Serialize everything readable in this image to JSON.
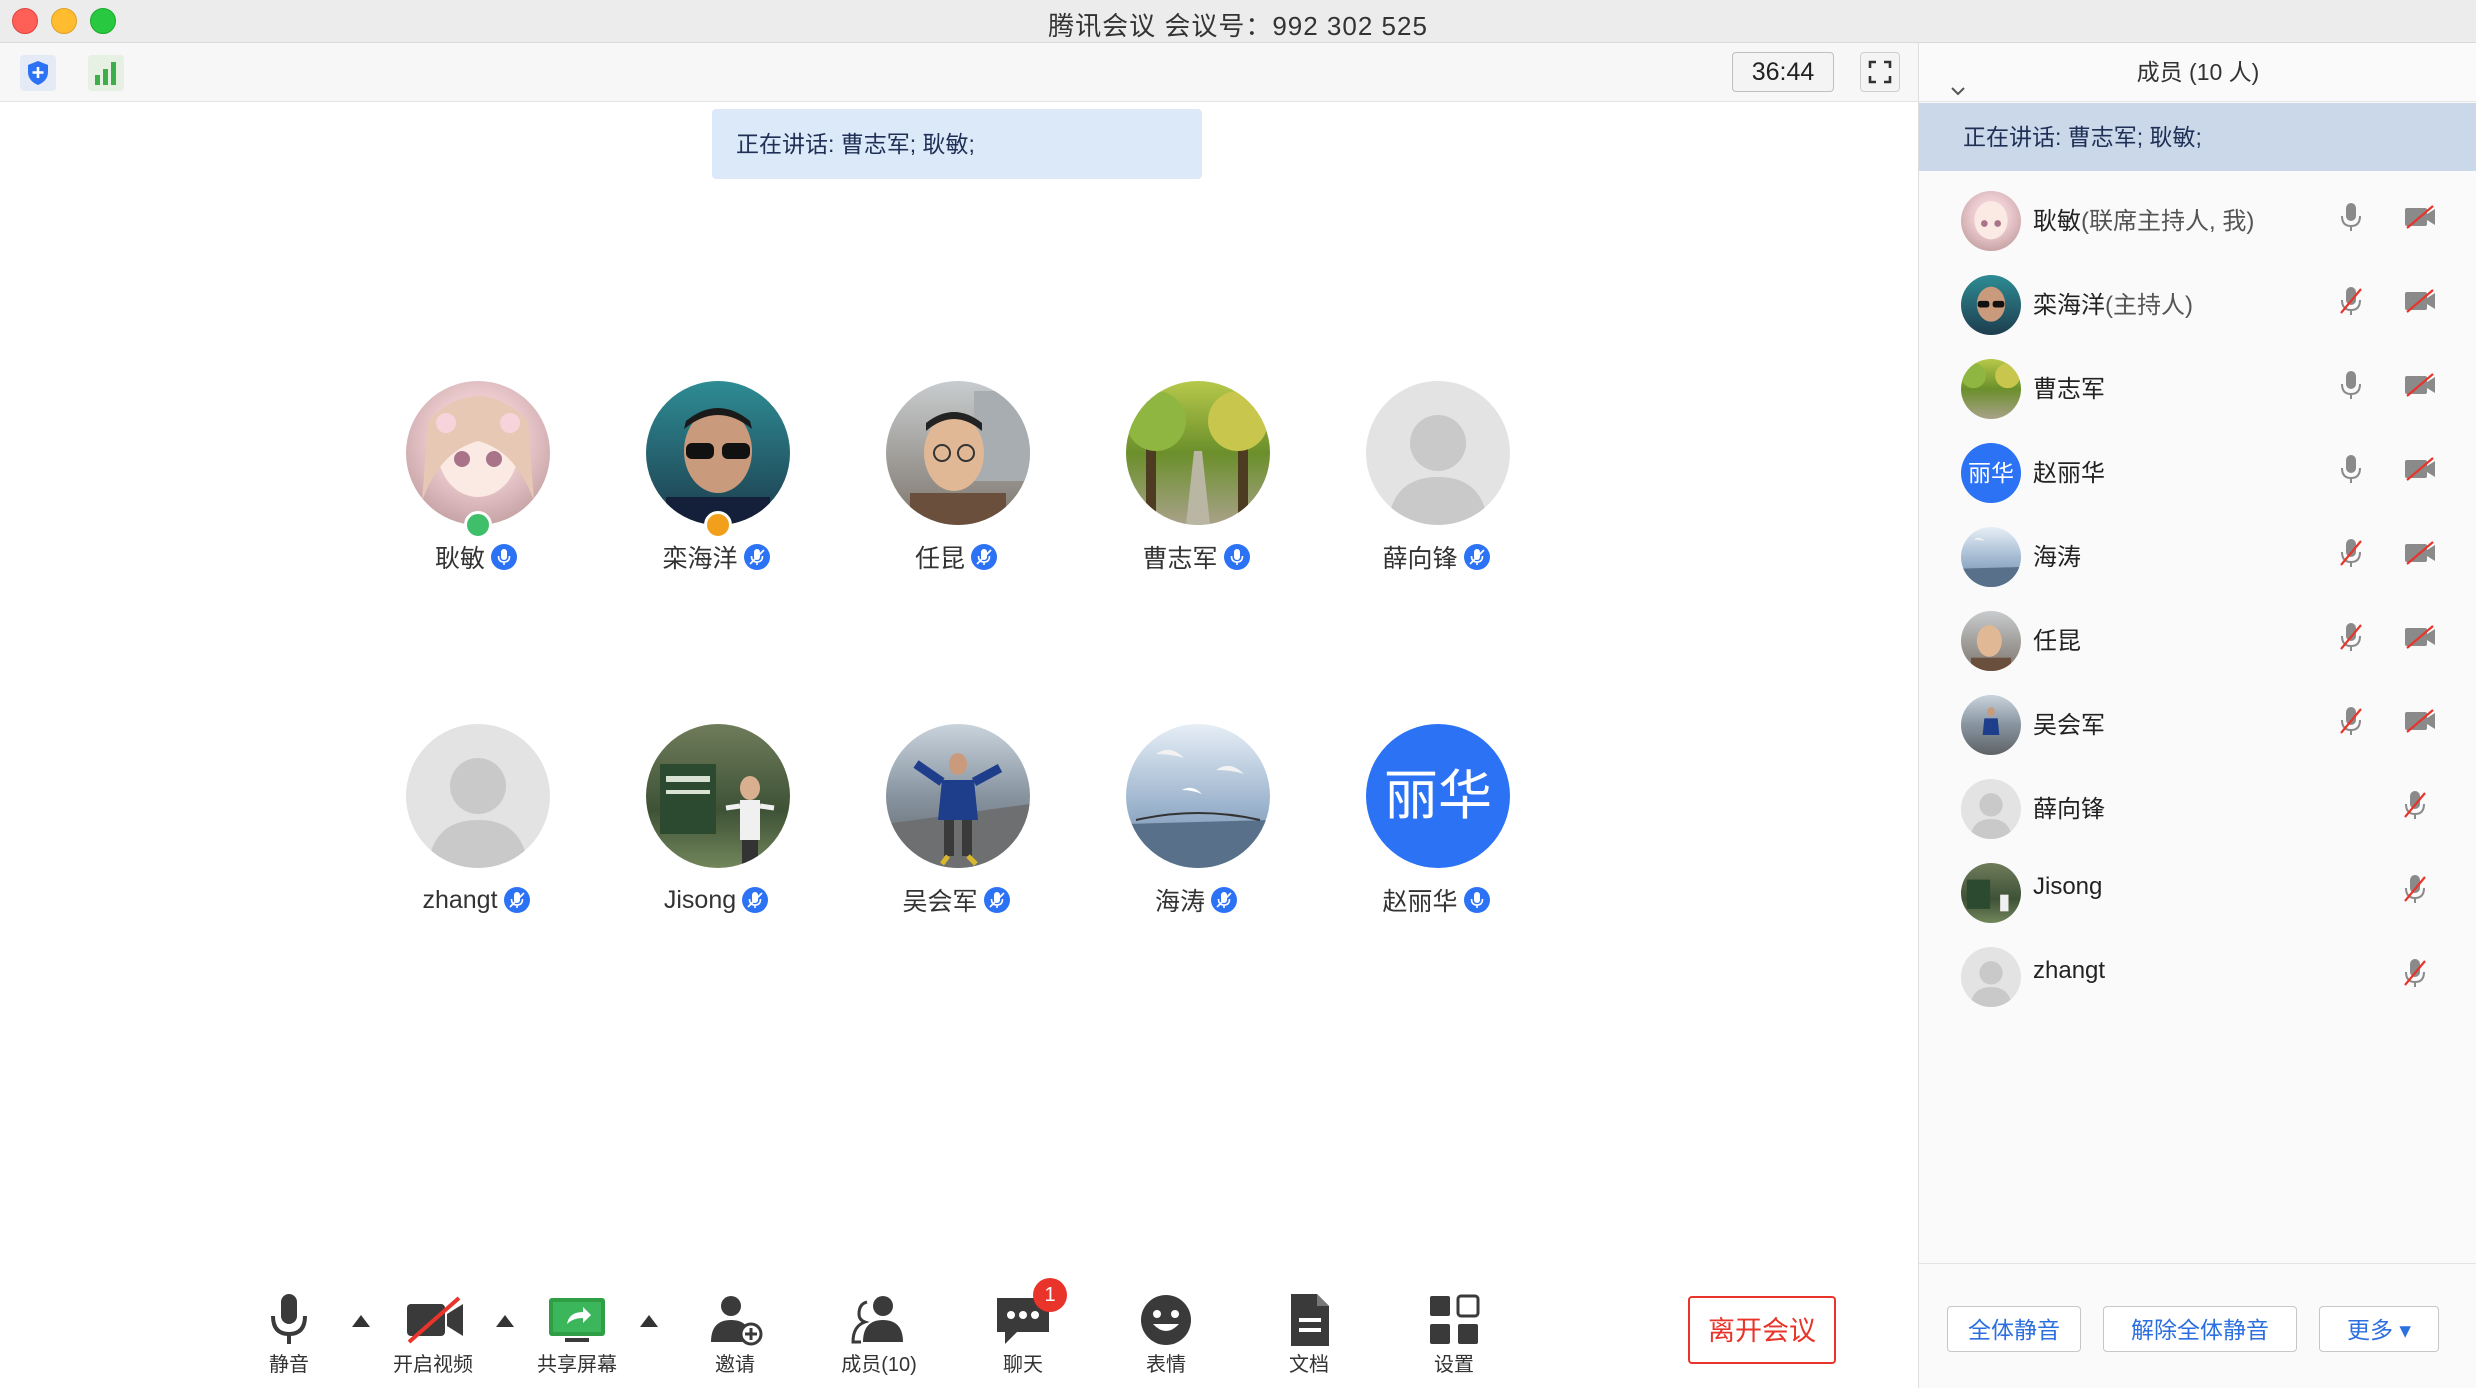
{
  "window": {
    "title": "腾讯会议 会议号：992 302 525"
  },
  "toolbar_top": {
    "timer": "36:44",
    "icons": [
      "shield-icon",
      "signal-strength-icon",
      "fullscreen-icon"
    ]
  },
  "speaking_banner": "正在讲话: 曹志军; 耿敏;",
  "tiles": [
    {
      "name": "耿敏",
      "avatar": "anime-girl",
      "badge": "green-host"
    },
    {
      "name": "栾海洋",
      "avatar": "man-sunglasses",
      "badge": "orange-host"
    },
    {
      "name": "任昆",
      "avatar": "man-glasses"
    },
    {
      "name": "曹志军",
      "avatar": "tree-path"
    },
    {
      "name": "薛向锋",
      "avatar": "default"
    },
    {
      "name": "zhangt",
      "avatar": "default"
    },
    {
      "name": "Jisong",
      "avatar": "man-sign"
    },
    {
      "name": "吴会军",
      "avatar": "man-bridge"
    },
    {
      "name": "海涛",
      "avatar": "seagulls"
    },
    {
      "name": "赵丽华",
      "avatar": "text",
      "avatar_text": "丽华"
    }
  ],
  "bottom_bar": {
    "mute": "静音",
    "video": "开启视频",
    "share": "共享屏幕",
    "invite": "邀请",
    "members": "成员(10)",
    "chat": "聊天",
    "chat_badge": "1",
    "emoji": "表情",
    "docs": "文档",
    "settings": "设置",
    "leave": "离开会议"
  },
  "panel": {
    "header": "成员 (10 人)",
    "speaking": "正在讲话: 曹志军; 耿敏;",
    "members": [
      {
        "name": "耿敏",
        "role": "(联席主持人, 我)",
        "avatar": "anime-girl",
        "mic": "on",
        "cam": "off"
      },
      {
        "name": "栾海洋",
        "role": "(主持人)",
        "avatar": "man-sunglasses",
        "mic": "muted",
        "cam": "off"
      },
      {
        "name": "曹志军",
        "role": "",
        "avatar": "tree-path",
        "mic": "on",
        "cam": "off"
      },
      {
        "name": "赵丽华",
        "role": "",
        "avatar": "text",
        "avatar_text": "丽华",
        "mic": "on",
        "cam": "off"
      },
      {
        "name": "海涛",
        "role": "",
        "avatar": "seagulls",
        "mic": "muted",
        "cam": "off"
      },
      {
        "name": "任昆",
        "role": "",
        "avatar": "man-glasses",
        "mic": "muted",
        "cam": "off"
      },
      {
        "name": "吴会军",
        "role": "",
        "avatar": "man-bridge",
        "mic": "muted",
        "cam": "off"
      },
      {
        "name": "薛向锋",
        "role": "",
        "avatar": "default",
        "mic": "muted-only"
      },
      {
        "name": "Jisong",
        "role": "",
        "avatar": "man-sign",
        "mic": "muted-only"
      },
      {
        "name": "zhangt",
        "role": "",
        "avatar": "default",
        "mic": "muted-only"
      }
    ],
    "footer": {
      "mute_all": "全体静音",
      "unmute_all": "解除全体静音",
      "more": "更多 ▾"
    }
  },
  "colors": {
    "accent": "#2c72f5",
    "leave": "#e8342a",
    "banner": "#dce9f8",
    "panel_speaking": "#cad8ea"
  }
}
